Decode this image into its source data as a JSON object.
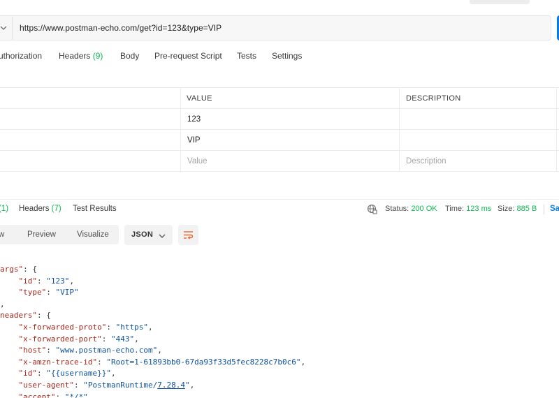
{
  "request": {
    "url": "https://www.postman-echo.com/get?id=123&type=VIP",
    "tabs": [
      {
        "label": "uthorization",
        "count": ""
      },
      {
        "label": "Headers",
        "count": "(9)"
      },
      {
        "label": "Body",
        "count": ""
      },
      {
        "label": "Pre-request Script",
        "count": ""
      },
      {
        "label": "Tests",
        "count": ""
      },
      {
        "label": "Settings",
        "count": ""
      }
    ]
  },
  "params": {
    "headers": {
      "value": "VALUE",
      "description": "DESCRIPTION"
    },
    "rows": [
      {
        "value": "123",
        "description": ""
      },
      {
        "value": "VIP",
        "description": ""
      }
    ],
    "placeholder": {
      "value": "Value",
      "description": "Description"
    }
  },
  "response": {
    "tabs": [
      {
        "label": "",
        "count": "(1)"
      },
      {
        "label": "Headers",
        "count": "(7)"
      },
      {
        "label": "Test Results",
        "count": ""
      }
    ],
    "status_label": "Status:",
    "status_value": "200 OK",
    "time_label": "Time:",
    "time_value": "123 ms",
    "size_label": "Size:",
    "size_value": "885 B",
    "save_label": "Sa",
    "views": [
      "w",
      "Preview",
      "Visualize"
    ],
    "format": "JSON"
  },
  "body_lines": [
    [
      {
        "t": "k",
        "v": "args\""
      },
      {
        "t": "p",
        "v": ": {"
      }
    ],
    [
      {
        "t": "p",
        "v": "    "
      },
      {
        "t": "k",
        "v": "\"id\""
      },
      {
        "t": "p",
        "v": ": "
      },
      {
        "t": "s",
        "v": "\"123\""
      },
      {
        "t": "p",
        "v": ","
      }
    ],
    [
      {
        "t": "p",
        "v": "    "
      },
      {
        "t": "k",
        "v": "\"type\""
      },
      {
        "t": "p",
        "v": ": "
      },
      {
        "t": "s",
        "v": "\"VIP\""
      }
    ],
    [
      {
        "t": "p",
        "v": ","
      }
    ],
    [
      {
        "t": "k",
        "v": "neaders\""
      },
      {
        "t": "p",
        "v": ": {"
      }
    ],
    [
      {
        "t": "p",
        "v": "    "
      },
      {
        "t": "k",
        "v": "\"x-forwarded-proto\""
      },
      {
        "t": "p",
        "v": ": "
      },
      {
        "t": "s",
        "v": "\"https\""
      },
      {
        "t": "p",
        "v": ","
      }
    ],
    [
      {
        "t": "p",
        "v": "    "
      },
      {
        "t": "k",
        "v": "\"x-forwarded-port\""
      },
      {
        "t": "p",
        "v": ": "
      },
      {
        "t": "s",
        "v": "\"443\""
      },
      {
        "t": "p",
        "v": ","
      }
    ],
    [
      {
        "t": "p",
        "v": "    "
      },
      {
        "t": "k",
        "v": "\"host\""
      },
      {
        "t": "p",
        "v": ": "
      },
      {
        "t": "s",
        "v": "\"www.postman-echo.com\""
      },
      {
        "t": "p",
        "v": ","
      }
    ],
    [
      {
        "t": "p",
        "v": "    "
      },
      {
        "t": "k",
        "v": "\"x-amzn-trace-id\""
      },
      {
        "t": "p",
        "v": ": "
      },
      {
        "t": "s",
        "v": "\"Root=1-61893bb0-67da93f33d5fec8228c7b0c6\""
      },
      {
        "t": "p",
        "v": ","
      }
    ],
    [
      {
        "t": "p",
        "v": "    "
      },
      {
        "t": "k",
        "v": "\"id\""
      },
      {
        "t": "p",
        "v": ": "
      },
      {
        "t": "s",
        "v": "\"{{username}}\""
      },
      {
        "t": "p",
        "v": ","
      }
    ],
    [
      {
        "t": "p",
        "v": "    "
      },
      {
        "t": "k",
        "v": "\"user-agent\""
      },
      {
        "t": "p",
        "v": ": "
      },
      {
        "t": "s",
        "v": "\"PostmanRuntime/"
      },
      {
        "t": "su",
        "v": "7.28.4"
      },
      {
        "t": "s",
        "v": "\""
      },
      {
        "t": "p",
        "v": ","
      }
    ],
    [
      {
        "t": "p",
        "v": "    "
      },
      {
        "t": "k",
        "v": "\"accept\""
      },
      {
        "t": "p",
        "v": ": "
      },
      {
        "t": "s",
        "v": "\"*/*\""
      },
      {
        "t": "p",
        "v": ","
      }
    ]
  ]
}
